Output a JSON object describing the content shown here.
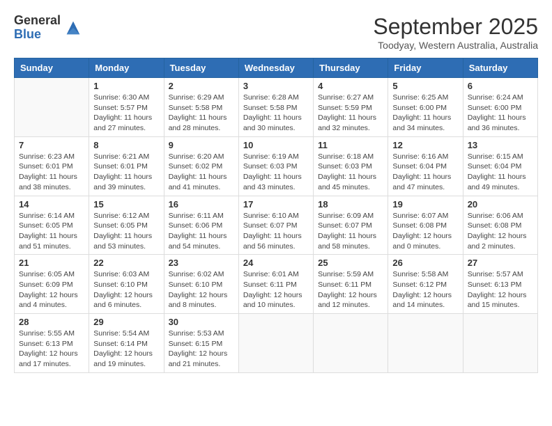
{
  "logo": {
    "general": "General",
    "blue": "Blue"
  },
  "title": "September 2025",
  "subtitle": "Toodyay, Western Australia, Australia",
  "days_header": [
    "Sunday",
    "Monday",
    "Tuesday",
    "Wednesday",
    "Thursday",
    "Friday",
    "Saturday"
  ],
  "weeks": [
    [
      {
        "day": "",
        "info": ""
      },
      {
        "day": "1",
        "info": "Sunrise: 6:30 AM\nSunset: 5:57 PM\nDaylight: 11 hours\nand 27 minutes."
      },
      {
        "day": "2",
        "info": "Sunrise: 6:29 AM\nSunset: 5:58 PM\nDaylight: 11 hours\nand 28 minutes."
      },
      {
        "day": "3",
        "info": "Sunrise: 6:28 AM\nSunset: 5:58 PM\nDaylight: 11 hours\nand 30 minutes."
      },
      {
        "day": "4",
        "info": "Sunrise: 6:27 AM\nSunset: 5:59 PM\nDaylight: 11 hours\nand 32 minutes."
      },
      {
        "day": "5",
        "info": "Sunrise: 6:25 AM\nSunset: 6:00 PM\nDaylight: 11 hours\nand 34 minutes."
      },
      {
        "day": "6",
        "info": "Sunrise: 6:24 AM\nSunset: 6:00 PM\nDaylight: 11 hours\nand 36 minutes."
      }
    ],
    [
      {
        "day": "7",
        "info": "Sunrise: 6:23 AM\nSunset: 6:01 PM\nDaylight: 11 hours\nand 38 minutes."
      },
      {
        "day": "8",
        "info": "Sunrise: 6:21 AM\nSunset: 6:01 PM\nDaylight: 11 hours\nand 39 minutes."
      },
      {
        "day": "9",
        "info": "Sunrise: 6:20 AM\nSunset: 6:02 PM\nDaylight: 11 hours\nand 41 minutes."
      },
      {
        "day": "10",
        "info": "Sunrise: 6:19 AM\nSunset: 6:03 PM\nDaylight: 11 hours\nand 43 minutes."
      },
      {
        "day": "11",
        "info": "Sunrise: 6:18 AM\nSunset: 6:03 PM\nDaylight: 11 hours\nand 45 minutes."
      },
      {
        "day": "12",
        "info": "Sunrise: 6:16 AM\nSunset: 6:04 PM\nDaylight: 11 hours\nand 47 minutes."
      },
      {
        "day": "13",
        "info": "Sunrise: 6:15 AM\nSunset: 6:04 PM\nDaylight: 11 hours\nand 49 minutes."
      }
    ],
    [
      {
        "day": "14",
        "info": "Sunrise: 6:14 AM\nSunset: 6:05 PM\nDaylight: 11 hours\nand 51 minutes."
      },
      {
        "day": "15",
        "info": "Sunrise: 6:12 AM\nSunset: 6:05 PM\nDaylight: 11 hours\nand 53 minutes."
      },
      {
        "day": "16",
        "info": "Sunrise: 6:11 AM\nSunset: 6:06 PM\nDaylight: 11 hours\nand 54 minutes."
      },
      {
        "day": "17",
        "info": "Sunrise: 6:10 AM\nSunset: 6:07 PM\nDaylight: 11 hours\nand 56 minutes."
      },
      {
        "day": "18",
        "info": "Sunrise: 6:09 AM\nSunset: 6:07 PM\nDaylight: 11 hours\nand 58 minutes."
      },
      {
        "day": "19",
        "info": "Sunrise: 6:07 AM\nSunset: 6:08 PM\nDaylight: 12 hours\nand 0 minutes."
      },
      {
        "day": "20",
        "info": "Sunrise: 6:06 AM\nSunset: 6:08 PM\nDaylight: 12 hours\nand 2 minutes."
      }
    ],
    [
      {
        "day": "21",
        "info": "Sunrise: 6:05 AM\nSunset: 6:09 PM\nDaylight: 12 hours\nand 4 minutes."
      },
      {
        "day": "22",
        "info": "Sunrise: 6:03 AM\nSunset: 6:10 PM\nDaylight: 12 hours\nand 6 minutes."
      },
      {
        "day": "23",
        "info": "Sunrise: 6:02 AM\nSunset: 6:10 PM\nDaylight: 12 hours\nand 8 minutes."
      },
      {
        "day": "24",
        "info": "Sunrise: 6:01 AM\nSunset: 6:11 PM\nDaylight: 12 hours\nand 10 minutes."
      },
      {
        "day": "25",
        "info": "Sunrise: 5:59 AM\nSunset: 6:11 PM\nDaylight: 12 hours\nand 12 minutes."
      },
      {
        "day": "26",
        "info": "Sunrise: 5:58 AM\nSunset: 6:12 PM\nDaylight: 12 hours\nand 14 minutes."
      },
      {
        "day": "27",
        "info": "Sunrise: 5:57 AM\nSunset: 6:13 PM\nDaylight: 12 hours\nand 15 minutes."
      }
    ],
    [
      {
        "day": "28",
        "info": "Sunrise: 5:55 AM\nSunset: 6:13 PM\nDaylight: 12 hours\nand 17 minutes."
      },
      {
        "day": "29",
        "info": "Sunrise: 5:54 AM\nSunset: 6:14 PM\nDaylight: 12 hours\nand 19 minutes."
      },
      {
        "day": "30",
        "info": "Sunrise: 5:53 AM\nSunset: 6:15 PM\nDaylight: 12 hours\nand 21 minutes."
      },
      {
        "day": "",
        "info": ""
      },
      {
        "day": "",
        "info": ""
      },
      {
        "day": "",
        "info": ""
      },
      {
        "day": "",
        "info": ""
      }
    ]
  ]
}
